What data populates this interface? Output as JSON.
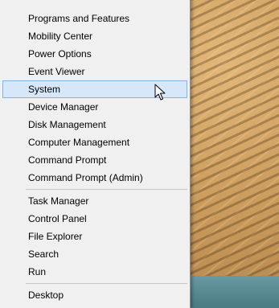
{
  "menu": {
    "groups": [
      {
        "items": [
          {
            "label": "Programs and Features"
          },
          {
            "label": "Mobility Center"
          },
          {
            "label": "Power Options"
          },
          {
            "label": "Event Viewer"
          },
          {
            "label": "System"
          },
          {
            "label": "Device Manager"
          },
          {
            "label": "Disk Management"
          },
          {
            "label": "Computer Management"
          },
          {
            "label": "Command Prompt"
          },
          {
            "label": "Command Prompt (Admin)"
          }
        ]
      },
      {
        "items": [
          {
            "label": "Task Manager"
          },
          {
            "label": "Control Panel"
          },
          {
            "label": "File Explorer"
          },
          {
            "label": "Search"
          },
          {
            "label": "Run"
          }
        ]
      },
      {
        "items": [
          {
            "label": "Desktop"
          }
        ]
      }
    ],
    "highlighted_item": "System"
  },
  "cursor": {
    "icon": "arrow-pointer-icon"
  },
  "colors": {
    "menu_background": "#f0f0f0",
    "highlight_background": "#d5e7f8",
    "highlight_border": "#7eb4ea",
    "separator": "#c5c5c5"
  }
}
